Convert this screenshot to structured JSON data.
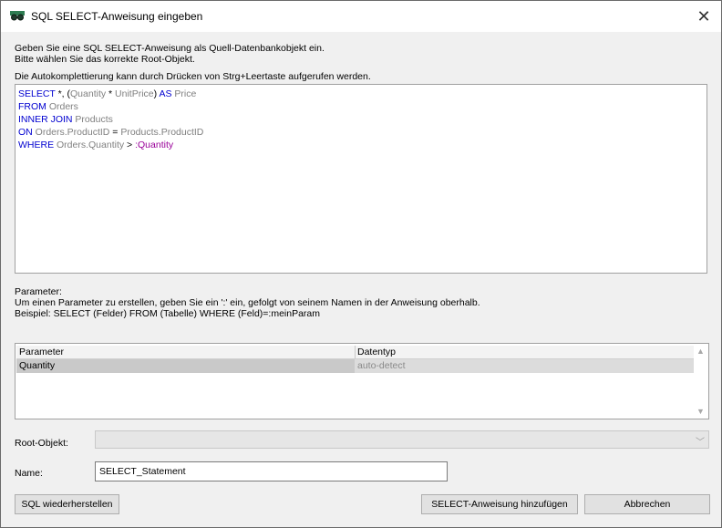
{
  "window": {
    "title": "SQL SELECT-Anweisung eingeben",
    "close_glyph": "✕"
  },
  "intro": {
    "line1": "Geben Sie eine SQL SELECT-Anweisung als Quell-Datenbankobjekt ein.",
    "line2": "Bitte wählen Sie das korrekte Root-Objekt.",
    "line3": "Die Autokomplettierung kann durch Drücken von Strg+Leertaste aufgerufen werden."
  },
  "sql": {
    "l1": {
      "kw1": "SELECT",
      "t1": " *, (",
      "id1": "Quantity",
      "t2": " * ",
      "id2": "UnitPrice",
      "t3": ") ",
      "kw2": "AS",
      "id3": " Price"
    },
    "l2": {
      "kw": "FROM",
      "id": " Orders"
    },
    "l3": {
      "kw": "INNER JOIN",
      "id": " Products"
    },
    "l4": {
      "kw": "ON",
      "id1": " Orders.ProductID",
      "t": " = ",
      "id2": "Products.ProductID"
    },
    "l5": {
      "kw": "WHERE",
      "id": " Orders.Quantity",
      "t": " > ",
      "param": ":Quantity"
    }
  },
  "params_help": {
    "heading": "Parameter:",
    "line1": "Um einen Parameter zu erstellen, geben Sie ein ':' ein, gefolgt von seinem Namen in der Anweisung oberhalb.",
    "line2": "Beispiel: SELECT (Felder) FROM (Tabelle) WHERE (Feld)=:meinParam"
  },
  "grid": {
    "col_parameter": "Parameter",
    "col_type": "Datentyp",
    "rows": [
      {
        "parameter": "Quantity",
        "type": "auto-detect"
      }
    ]
  },
  "root": {
    "label": "Root-Objekt:",
    "value": ""
  },
  "name": {
    "label": "Name:",
    "value": "SELECT_Statement"
  },
  "buttons": {
    "restore": "SQL wiederherstellen",
    "add": "SELECT-Anweisung hinzufügen",
    "cancel": "Abbrechen"
  }
}
